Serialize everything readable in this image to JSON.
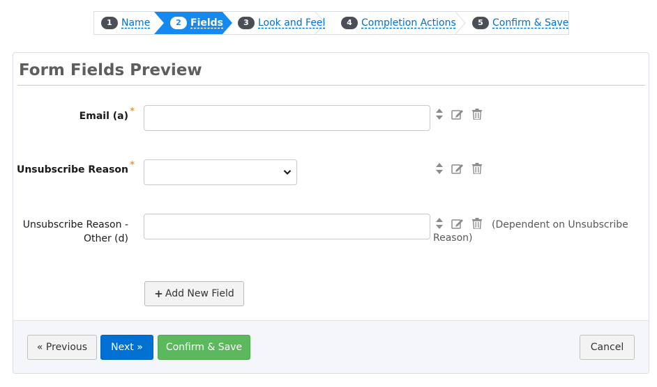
{
  "wizard": {
    "steps": [
      {
        "number": "1",
        "label": "Name"
      },
      {
        "number": "2",
        "label": "Fields"
      },
      {
        "number": "3",
        "label": "Look and Feel"
      },
      {
        "number": "4",
        "label": "Completion Actions"
      },
      {
        "number": "5",
        "label": "Confirm & Save"
      }
    ],
    "active_step": 2
  },
  "panel": {
    "title": "Form Fields Preview"
  },
  "fields": [
    {
      "label": "Email (a)",
      "required": true,
      "required_mark": "*",
      "type": "text",
      "value": ""
    },
    {
      "label": "Unsubscribe Reason",
      "required": true,
      "required_mark": "*",
      "type": "select",
      "value": ""
    },
    {
      "label_line1": "Unsubscribe Reason -",
      "label_line2": "Other (d)",
      "required": false,
      "type": "text",
      "value": "",
      "note": "(Dependent on Unsubscribe Reason)"
    }
  ],
  "icons": {
    "sort": "sort-arrows-icon",
    "edit": "edit-icon",
    "delete": "trash-icon",
    "plus": "plus-icon",
    "caret": "chevron-down-icon"
  },
  "add_field_button": {
    "label": "Add New Field"
  },
  "footer": {
    "previous_label": "« Previous",
    "next_label": "Next »",
    "confirm_save_label": "Confirm & Save",
    "cancel_label": "Cancel"
  },
  "colors": {
    "active_step": "#1589ee",
    "link": "#0070d2",
    "next_button": "#0070d2",
    "save_button": "#5cb85c",
    "required": "#f29b30"
  }
}
